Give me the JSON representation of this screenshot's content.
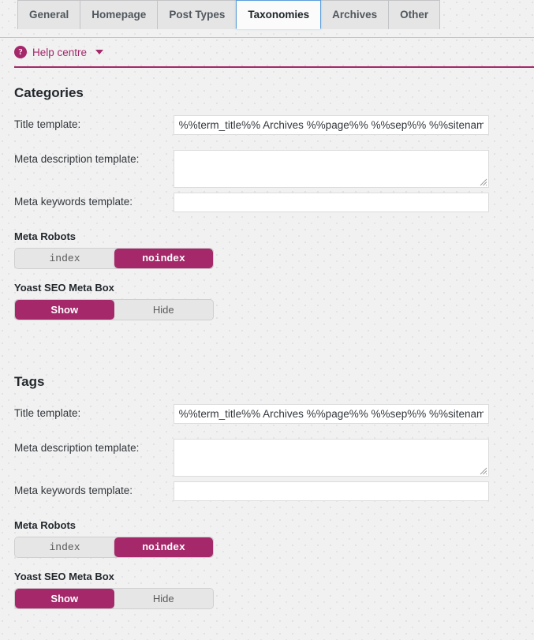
{
  "tabs": [
    {
      "label": "General",
      "active": false
    },
    {
      "label": "Homepage",
      "active": false
    },
    {
      "label": "Post Types",
      "active": false
    },
    {
      "label": "Taxonomies",
      "active": true
    },
    {
      "label": "Archives",
      "active": false
    },
    {
      "label": "Other",
      "active": false
    }
  ],
  "help": {
    "icon": "question-mark-circle-icon",
    "label": "Help centre",
    "caret": "chevron-down-icon"
  },
  "colors": {
    "accent": "#a4286a",
    "active_tab_border": "#5b9dd9",
    "page_background": "#f1f1f1",
    "field_border": "#dcdcdc"
  },
  "sections": [
    {
      "id": "categories",
      "title": "Categories",
      "title_template": {
        "label": "Title template:",
        "value": "%%term_title%% Archives %%page%% %%sep%% %%sitename%%",
        "placeholder": ""
      },
      "meta_description_template": {
        "label": "Meta description template:",
        "value": "",
        "placeholder": ""
      },
      "meta_keywords_template": {
        "label": "Meta keywords template:",
        "value": "",
        "placeholder": ""
      },
      "meta_robots": {
        "label": "Meta Robots",
        "options": [
          "index",
          "noindex"
        ],
        "selected": "noindex"
      },
      "meta_box": {
        "label": "Yoast SEO Meta Box",
        "options": [
          "Show",
          "Hide"
        ],
        "selected": "Show"
      }
    },
    {
      "id": "tags",
      "title": "Tags",
      "title_template": {
        "label": "Title template:",
        "value": "%%term_title%% Archives %%page%% %%sep%% %%sitename%%",
        "placeholder": ""
      },
      "meta_description_template": {
        "label": "Meta description template:",
        "value": "",
        "placeholder": ""
      },
      "meta_keywords_template": {
        "label": "Meta keywords template:",
        "value": "",
        "placeholder": ""
      },
      "meta_robots": {
        "label": "Meta Robots",
        "options": [
          "index",
          "noindex"
        ],
        "selected": "noindex"
      },
      "meta_box": {
        "label": "Yoast SEO Meta Box",
        "options": [
          "Show",
          "Hide"
        ],
        "selected": "Show"
      }
    }
  ]
}
